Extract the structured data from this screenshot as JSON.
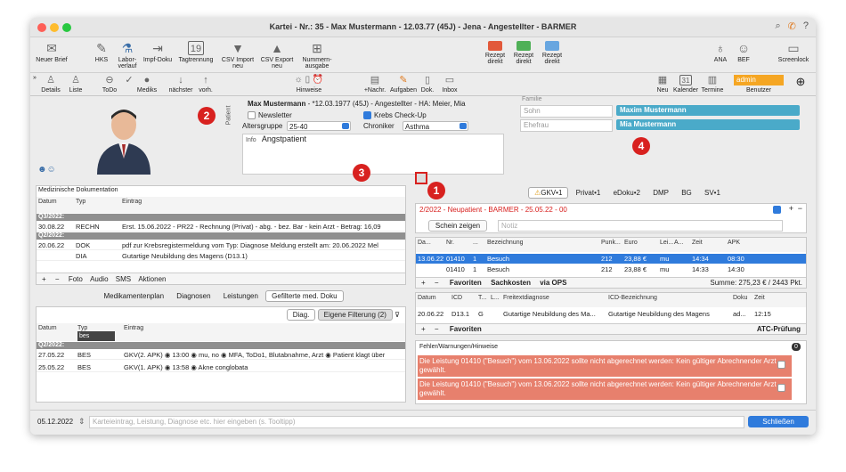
{
  "window": {
    "title": "Kartei - Nr.: 35 - Max Mustermann - 12.03.77 (45J) - Jena - Angestellter - BARMER"
  },
  "toolbar1": {
    "items": [
      "Neuer Brief",
      "HKS",
      "Labor-verlauf",
      "Impf-Doku",
      "Tagtrennung",
      "CSV Import neu",
      "CSV Export neu",
      "Nummern-ausgabe",
      "Rezept direkt",
      "Rezept direkt",
      "Rezept direkt",
      "ANA",
      "BEF",
      "Screenlock"
    ],
    "date_icon": "19"
  },
  "toolbar2": {
    "items": [
      "Details",
      "Liste",
      "ToDo",
      "Mediks",
      "nächster",
      "vorh.",
      "Hinweise",
      "+Nachr.",
      "Aufgaben",
      "Dok.",
      "Inbox",
      "Neu",
      "Kalender",
      "Termine",
      "Benutzer"
    ],
    "admin": "admin",
    "cal_day": "31"
  },
  "badges": [
    "1",
    "2",
    "3",
    "4"
  ],
  "patient": {
    "label": "Patient",
    "name": "Max Mustermann",
    "details": " - *12.03.1977 (45J) - Angestellter - HA: Meier, Mia",
    "newsletter": "Newsletter",
    "krebs": "Krebs Check-Up",
    "altersgruppe_label": "Altersgruppe",
    "altersgruppe": "25-40",
    "chroniker_label": "Chroniker",
    "chroniker": "Asthma",
    "info_label": "Info",
    "info": "Angstpatient"
  },
  "family": {
    "label": "Familie",
    "rows": [
      {
        "rel": "Sohn",
        "name": "Maxim Mustermann"
      },
      {
        "rel": "Ehefrau",
        "name": "Mia Mustermann"
      }
    ]
  },
  "meddoc": {
    "title": "Medizinische Dokumentation",
    "headers": [
      "Datum",
      "Typ",
      "Eintrag"
    ],
    "rows": [
      {
        "g": "Q3/2022:"
      },
      {
        "d": "30.08.22",
        "t": "RECHN",
        "e": "Erst. 15.06.2022 - PR22 - Rechnung (Privat) - abg. - bez. Bar - kein Arzt - Betrag: 16,09"
      },
      {
        "g": "Q2/2022:"
      },
      {
        "d": "20.06.22",
        "t": "DOK",
        "e": "pdf zur Krebsregistermeldung vom Typ: Diagnose  Meldung erstellt am: 20.06.2022 Mel"
      },
      {
        "d": "",
        "t": "DIA",
        "e": "Gutartige Neubildung des Magens (D13.1)"
      }
    ],
    "footer": [
      "+",
      "−",
      "Foto",
      "Audio",
      "SMS",
      "Aktionen"
    ]
  },
  "midtabs": {
    "tabs": [
      "Medikamentenplan",
      "Diagnosen",
      "Leistungen",
      "Gefilterte med. Doku"
    ],
    "diag": "Diag.",
    "filter": "Eigene Filterung (2)"
  },
  "filtered": {
    "headers": [
      "Datum",
      "Typ",
      "Eintrag"
    ],
    "typ_filter": "bes",
    "rows": [
      {
        "g": "Q2/2022:"
      },
      {
        "d": "27.05.22",
        "t": "BES",
        "e": "GKV(2. APK) ◉ 13:00 ◉ mu, no ◉ MFA, ToDo1, Blutabnahme, Arzt ◉ Patient klagt über"
      },
      {
        "d": "25.05.22",
        "t": "BES",
        "e": "GKV(1. APK) ◉ 13:58 ◉ Akne conglobata"
      }
    ]
  },
  "righttabs": [
    "GKV•1",
    "Privat•1",
    "eDoku•2",
    "DMP",
    "BG",
    "SV•1"
  ],
  "schein": {
    "title": "2/2022 - Neupatient - BARMER - 25.05.22 - 00",
    "btn": "Schein zeigen",
    "notiz": "Notiz"
  },
  "leist": {
    "headers": [
      "Da...",
      "Nr.",
      "...",
      "Bezeichnung",
      "Punk...",
      "Euro",
      "Lei...",
      "A...",
      "Zeit",
      "APK"
    ],
    "rows": [
      [
        "13.06.22",
        "01410",
        "1",
        "Besuch",
        "212",
        "23,88 €",
        "mu",
        "",
        "14:34",
        "08:30"
      ],
      [
        "",
        "01410",
        "1",
        "Besuch",
        "212",
        "23,88 €",
        "mu",
        "",
        "14:33",
        "14:30"
      ]
    ],
    "footer": [
      "+",
      "−",
      "Favoriten",
      "Sachkosten",
      "via OPS"
    ],
    "summe": "Summe: 275,23 € / 2443 Pkt."
  },
  "diag": {
    "headers": [
      "Datum",
      "ICD",
      "T...",
      "L...",
      "Freitextdiagnose",
      "ICD-Bezeichnung",
      "Doku",
      "Zeit"
    ],
    "row": [
      "20.06.22",
      "D13.1",
      "G",
      "",
      "Gutartige Neubildung des Ma...",
      "Gutartige Neubildung des Magens",
      "ad...",
      "12:15"
    ],
    "footer": [
      "+",
      "−",
      "Favoriten"
    ],
    "atc": "ATC-Prüfung"
  },
  "warn": {
    "title": "Fehler/Warnungen/Hinweise",
    "count": "0",
    "items": [
      "Die Leistung 01410 (\"Besuch\") vom 13.06.2022 sollte nicht abgerechnet werden: Kein gültiger Abrechnender Arzt gewählt.",
      "Die Leistung 01410 (\"Besuch\") vom 13.06.2022 sollte nicht abgerechnet werden: Kein gültiger Abrechnender Arzt gewählt."
    ]
  },
  "bottom": {
    "date": "05.12.2022",
    "placeholder": "Karteieintrag, Leistung, Diagnose etc. hier eingeben (s. Tooltipp)",
    "close": "Schließen"
  }
}
